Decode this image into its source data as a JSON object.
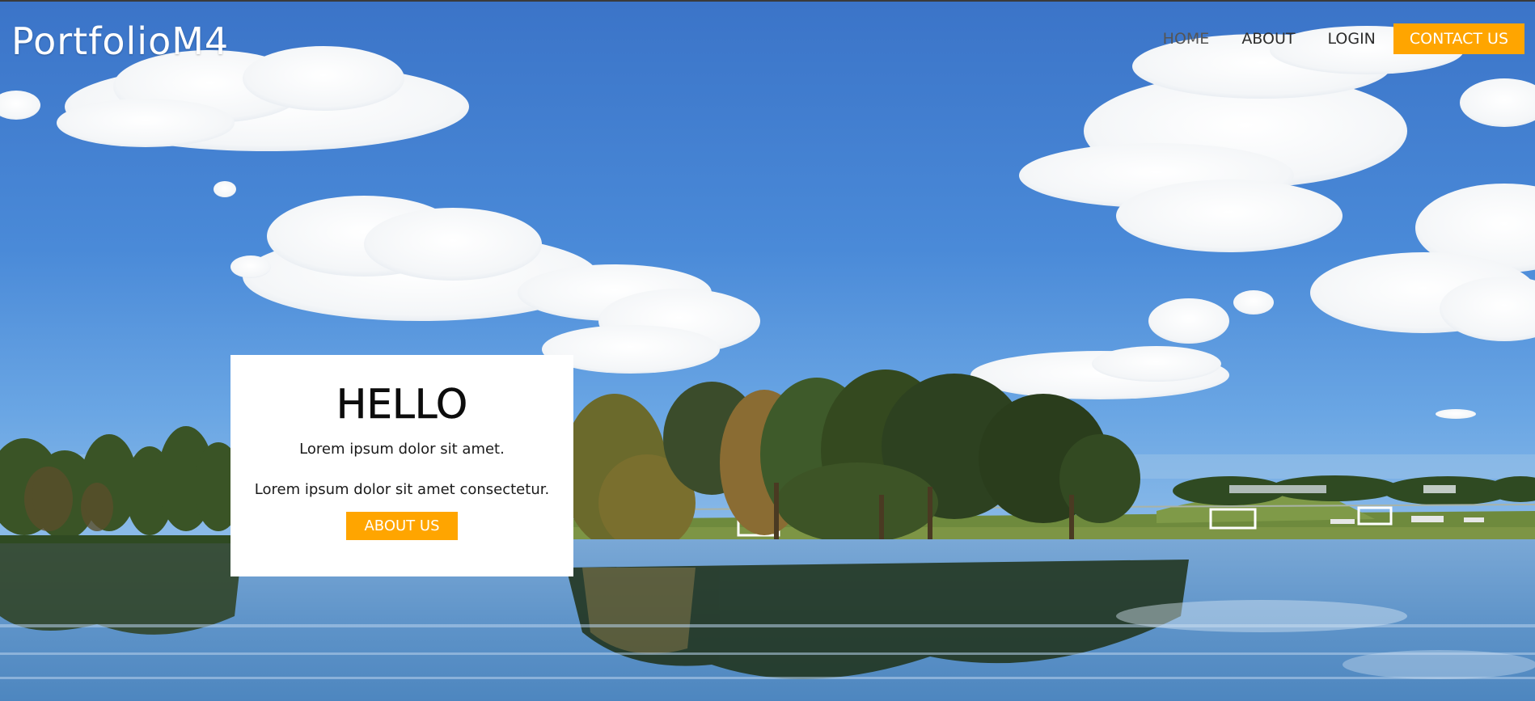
{
  "site": {
    "brand": "PortfolioM4"
  },
  "nav": {
    "items": [
      {
        "label": "HOME"
      },
      {
        "label": "ABOUT"
      },
      {
        "label": "LOGIN"
      }
    ],
    "cta_label": "CONTACT US"
  },
  "hero_card": {
    "title": "HELLO",
    "line1": "Lorem ipsum dolor sit amet.",
    "line2": "Lorem ipsum dolor sit amet consectetur.",
    "button_label": "ABOUT US"
  },
  "colors": {
    "accent": "#ffa500",
    "sky": "#3f7fd0",
    "card_bg": "#ffffff"
  },
  "background": {
    "image_content": "lake-park-landscape",
    "elements": [
      "blue-sky",
      "white-clouds",
      "trees",
      "grass-field",
      "soccer-goals",
      "lake-reflection"
    ]
  }
}
